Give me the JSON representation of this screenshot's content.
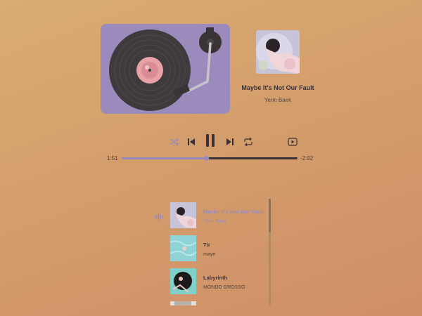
{
  "now_playing": {
    "title": "Maybe It's Not Our Fault",
    "artist": "Yerin Baek",
    "elapsed": "1:51",
    "remaining": "-2:02",
    "progress": 0.48
  },
  "controls": {
    "shuffle_icon": "shuffle-icon",
    "prev_icon": "skip-previous-icon",
    "pause_icon": "pause-icon",
    "next_icon": "skip-next-icon",
    "repeat_icon": "repeat-icon",
    "youtube_icon": "youtube-play-icon"
  },
  "playlist": [
    {
      "title": "Maybe It's Not Our Fault",
      "artist": "Yerin Baek",
      "active": true
    },
    {
      "title": "Tù",
      "artist": "maye",
      "active": false
    },
    {
      "title": "Labyrinth",
      "artist": "MONDO GROSSO",
      "active": false
    }
  ],
  "colors": {
    "accent": "#9b8bbd",
    "text_dark": "#3c3035",
    "vinyl": "#3f3b3d",
    "label": "#e8a1a6"
  }
}
